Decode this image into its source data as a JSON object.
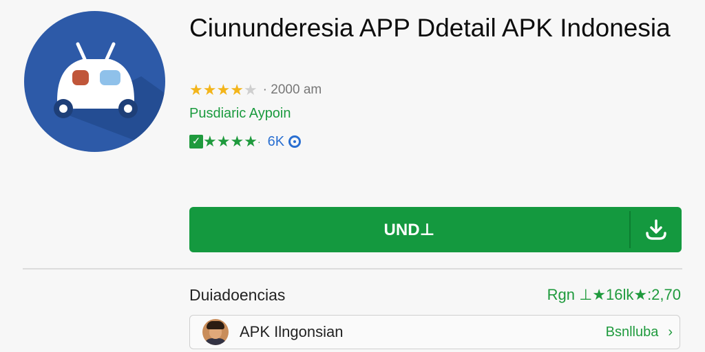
{
  "app": {
    "title": "Ciununderesia APP Ddetail APK Indonesia",
    "rating_text": "· 2000 am",
    "rating_stars": 4,
    "developer": "Pusdiaric Aypoin",
    "verified_count": "6K",
    "icon": "car-icon"
  },
  "download": {
    "label": "UND⊥",
    "icon": "download-icon"
  },
  "details": {
    "label": "Duiadoencias",
    "stats": "Rgn ⊥★16lk★:2,70"
  },
  "developer_row": {
    "name": "APK Ilngonsian",
    "link": "Bsnlluba",
    "chevron": "›"
  },
  "colors": {
    "accent": "#14993f",
    "icon_bg": "#2d5aa8",
    "star": "#f3b51b"
  }
}
